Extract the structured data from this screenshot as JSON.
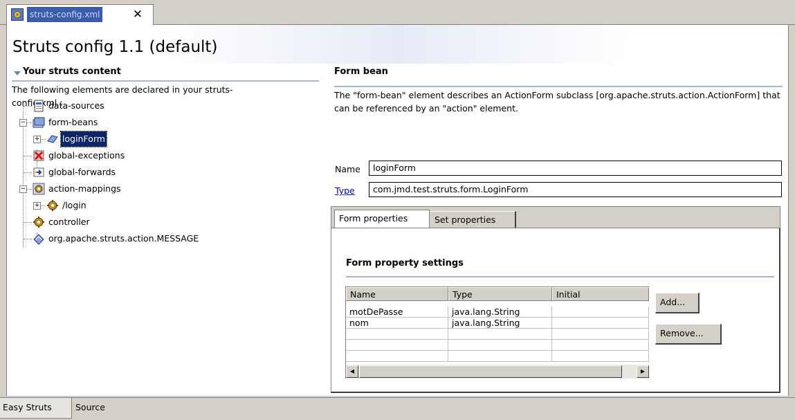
{
  "editor_tab": {
    "label": "struts-config.xml",
    "close": "✕"
  },
  "page": {
    "title": "Struts config 1.1 (default)"
  },
  "left": {
    "section_title": "Your struts content",
    "description": "The following elements are declared in your struts-config.xml :",
    "tree": [
      {
        "label": "data-sources",
        "icon": "datasource-icon"
      },
      {
        "label": "form-beans",
        "icon": "formbean-icon"
      },
      {
        "label": "loginForm",
        "icon": "form-icon"
      },
      {
        "label": "global-exceptions",
        "icon": "exception-icon"
      },
      {
        "label": "global-forwards",
        "icon": "forward-icon"
      },
      {
        "label": "action-mappings",
        "icon": "gear-icon"
      },
      {
        "label": "/login",
        "icon": "action-icon"
      },
      {
        "label": "controller",
        "icon": "controller-icon"
      },
      {
        "label": "org.apache.struts.action.MESSAGE",
        "icon": "message-icon"
      }
    ]
  },
  "right": {
    "section_title": "Form bean",
    "description": "The \"form-bean\" element describes an ActionForm subclass [org.apache.struts.action.ActionForm] that can be referenced by an \"action\" element.",
    "name_label": "Name",
    "name_value": "loginForm",
    "type_label": "Type",
    "type_value": "com.jmd.test.struts.form.LoginForm",
    "tabs": [
      "Form properties",
      "Set properties"
    ],
    "settings_title": "Form property settings",
    "table": {
      "headers": [
        "Name",
        "Type",
        "Initial"
      ],
      "rows": [
        [
          "motDePasse",
          "java.lang.String",
          ""
        ],
        [
          "nom",
          "java.lang.String",
          ""
        ]
      ]
    },
    "add_button": "Add...",
    "remove_button": "Remove..."
  },
  "page_tabs": [
    "Easy Struts",
    "Source"
  ],
  "colors": {
    "section_rule": "#a3b4cf",
    "selection": "#0a246a",
    "link": "#0000cc"
  }
}
